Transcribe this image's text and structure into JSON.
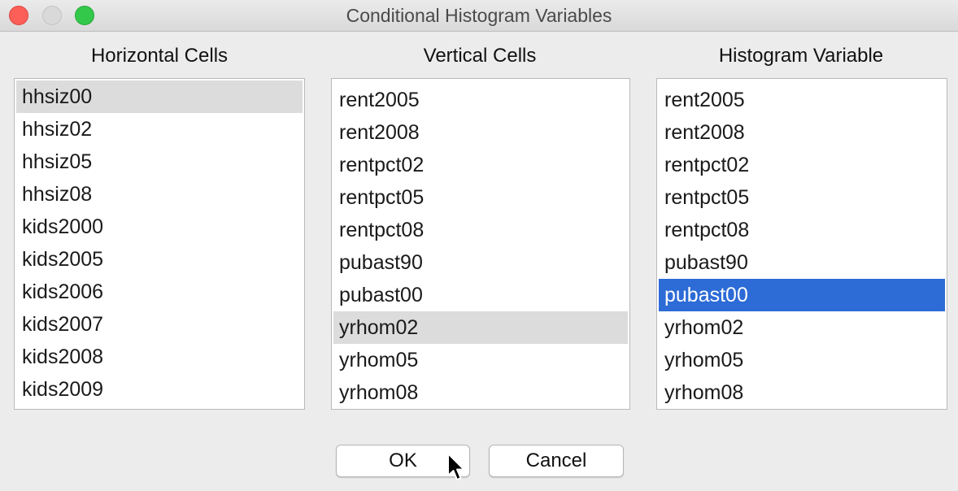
{
  "window": {
    "title": "Conditional Histogram Variables"
  },
  "columns": {
    "horizontal": {
      "label": "Horizontal Cells",
      "items": [
        "hhsiz00",
        "hhsiz02",
        "hhsiz05",
        "hhsiz08",
        "kids2000",
        "kids2005",
        "kids2006",
        "kids2007",
        "kids2008",
        "kids2009"
      ]
    },
    "vertical": {
      "label": "Vertical Cells",
      "items": [
        "rent2005",
        "rent2008",
        "rentpct02",
        "rentpct05",
        "rentpct08",
        "pubast90",
        "pubast00",
        "yrhom02",
        "yrhom05",
        "yrhom08"
      ]
    },
    "histogram": {
      "label": "Histogram Variable",
      "items": [
        "rent2005",
        "rent2008",
        "rentpct02",
        "rentpct05",
        "rentpct08",
        "pubast90",
        "pubast00",
        "yrhom02",
        "yrhom05",
        "yrhom08"
      ],
      "selected": "pubast00"
    }
  },
  "buttons": {
    "ok": "OK",
    "cancel": "Cancel"
  },
  "colors": {
    "selection": "#2d6bd6",
    "hover": "#dcdcdc",
    "close": "#fc5f57",
    "zoom": "#34c84a"
  },
  "icons": {
    "cursor": "arrow-cursor-icon"
  }
}
